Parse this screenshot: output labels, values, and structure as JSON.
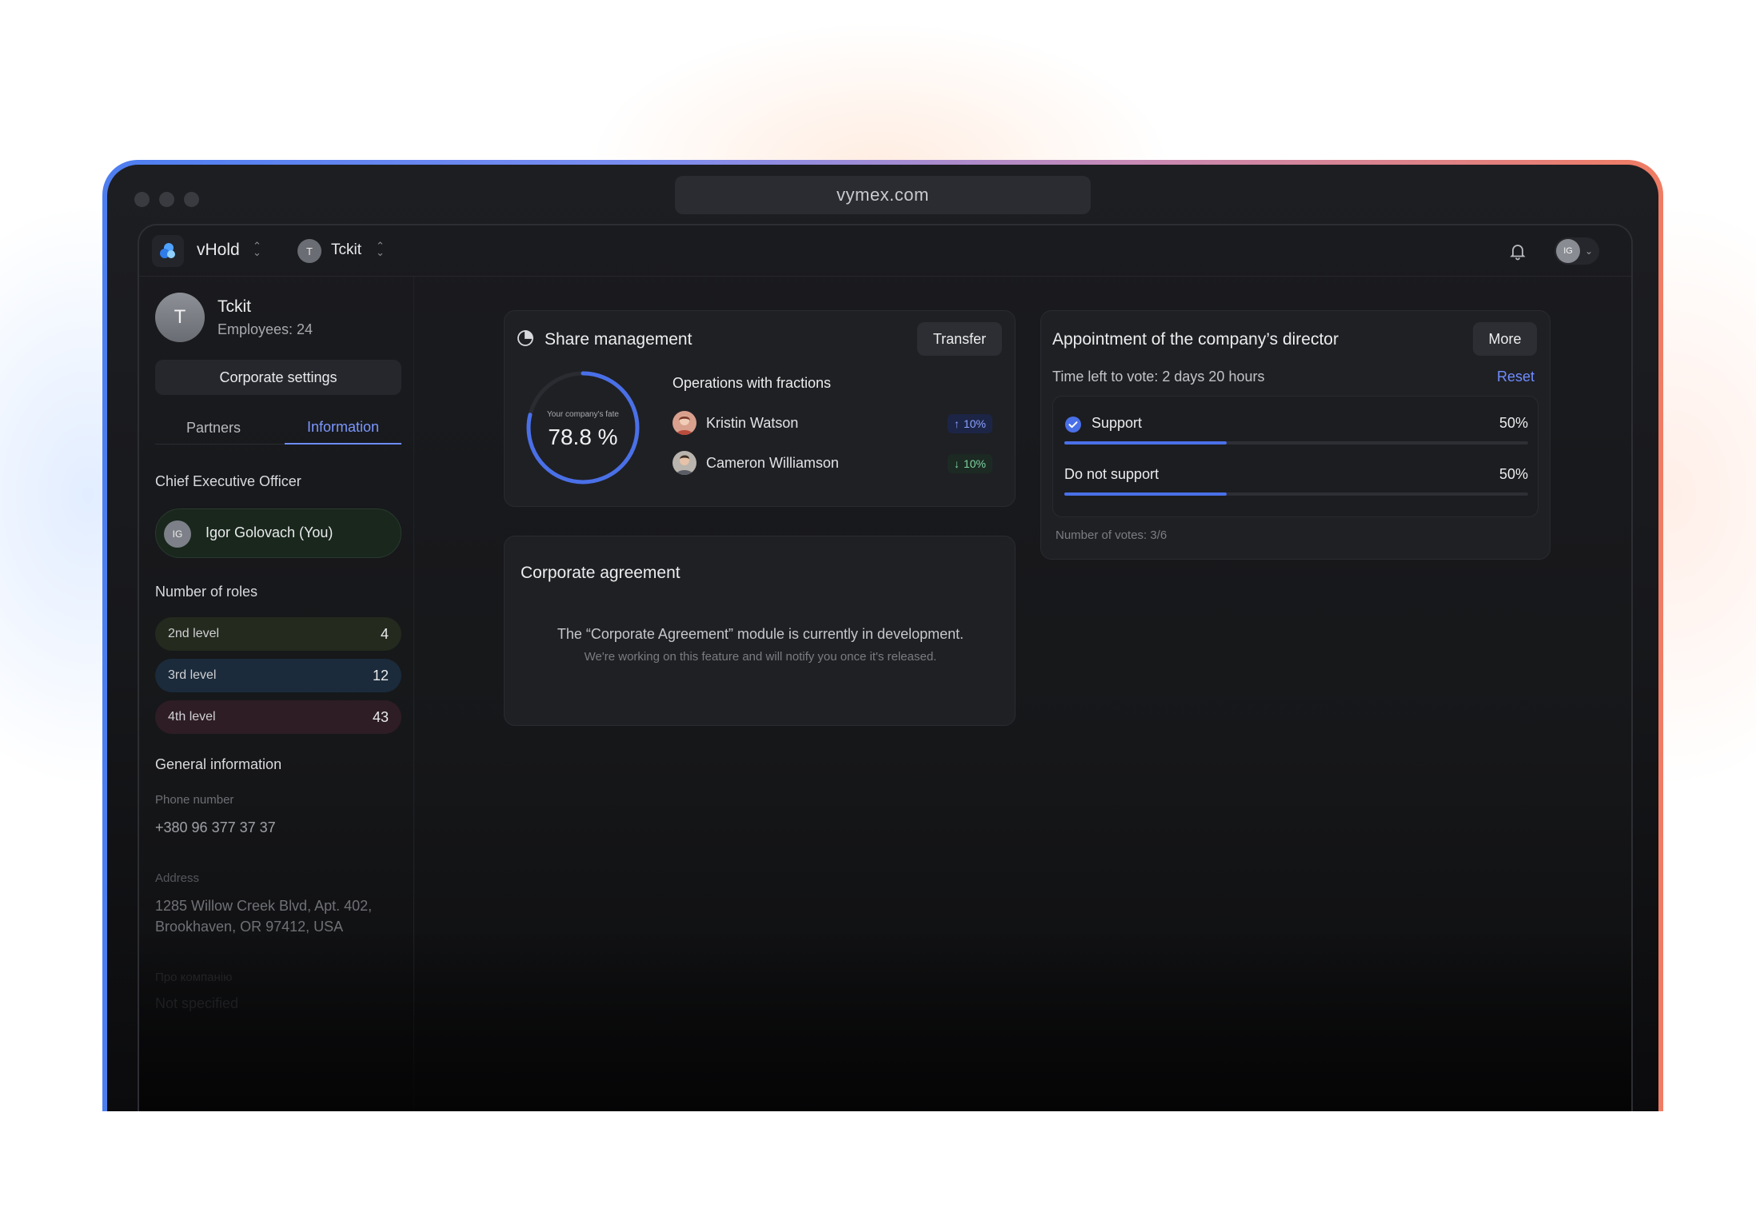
{
  "browser": {
    "url": "vymex.com"
  },
  "topbar": {
    "brand": "vHold",
    "company_initial": "T",
    "company": "Tckit",
    "user_initials": "IG"
  },
  "sidebar": {
    "profile_initial": "T",
    "profile_name": "Tckit",
    "employees": "Employees: 24",
    "settings_button": "Corporate settings",
    "tabs": [
      "Partners",
      "Information"
    ],
    "active_tab": "Information",
    "ceo_title": "Chief Executive Officer",
    "ceo_initials": "IG",
    "ceo_name": "Igor Golovach (You)",
    "roles_title": "Number of roles",
    "roles": [
      {
        "label": "2nd level",
        "count": "4",
        "color": "#242a1e"
      },
      {
        "label": "3rd level",
        "count": "12",
        "color": "#1b2b3b"
      },
      {
        "label": "4th level",
        "count": "43",
        "color": "#2e1d25"
      }
    ],
    "general_title": "General information",
    "phone_label": "Phone number",
    "phone": "+380 96 377 37 37",
    "address_label": "Address",
    "address_line1": "1285 Willow Creek Blvd, Apt. 402,",
    "address_line2": "Brookhaven, OR 97412, USA",
    "about_label": "Про компанію",
    "about_value": "Not specified"
  },
  "share": {
    "title": "Share management",
    "transfer_button": "Transfer",
    "gauge_caption": "Your company's fate",
    "gauge_value": "78.8 %",
    "gauge_fraction": 0.788,
    "ops_title": "Operations with fractions",
    "operations": [
      {
        "name": "Kristin Watson",
        "change": "10%",
        "direction": "up"
      },
      {
        "name": "Cameron Williamson",
        "change": "10%",
        "direction": "down"
      }
    ]
  },
  "agreement": {
    "title": "Corporate agreement",
    "message": "The “Corporate Agreement” module is currently in development.",
    "sub": "We're working on this feature and will notify you once it's released."
  },
  "vote": {
    "title": "Appointment of the company’s director",
    "more_button": "More",
    "time_left": "Time left to vote: 2 days 20 hours",
    "reset": "Reset",
    "options": [
      {
        "label": "Support",
        "pct": "50%",
        "fraction": 0.35,
        "checked": true
      },
      {
        "label": "Do not support",
        "pct": "50%",
        "fraction": 0.35,
        "checked": false
      }
    ],
    "votes_count": "Number of votes: 3/6"
  },
  "colors": {
    "accent": "#6d8cff",
    "bar": "#4a70e8",
    "gauge": "#4a70e8"
  },
  "icons": [
    "logo-icon",
    "sort-icon",
    "bell-icon",
    "chevron-down-icon",
    "pie-chart-icon",
    "arrow-up-icon",
    "arrow-down-icon",
    "check-circle-icon"
  ]
}
